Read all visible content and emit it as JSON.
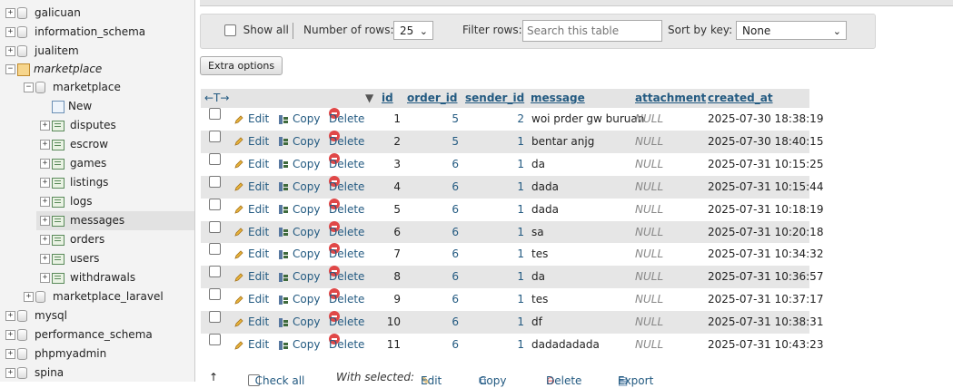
{
  "nav": {
    "items": [
      {
        "label": "galicuan",
        "depth": 0
      },
      {
        "label": "information_schema",
        "depth": 0
      },
      {
        "label": "jualitem",
        "depth": 0
      },
      {
        "label": "marketplace",
        "depth": 0,
        "italic": true
      },
      {
        "label": "marketplace",
        "depth": 1
      },
      {
        "label": "New",
        "depth": 2
      },
      {
        "label": "disputes",
        "depth": 2
      },
      {
        "label": "escrow",
        "depth": 2
      },
      {
        "label": "games",
        "depth": 2
      },
      {
        "label": "listings",
        "depth": 2
      },
      {
        "label": "logs",
        "depth": 2
      },
      {
        "label": "messages",
        "depth": 2
      },
      {
        "label": "orders",
        "depth": 2
      },
      {
        "label": "users",
        "depth": 2
      },
      {
        "label": "withdrawals",
        "depth": 2
      },
      {
        "label": "marketplace_laravel",
        "depth": 1
      },
      {
        "label": "mysql",
        "depth": 0
      },
      {
        "label": "performance_schema",
        "depth": 0
      },
      {
        "label": "phpmyadmin",
        "depth": 0
      },
      {
        "label": "spina",
        "depth": 0
      }
    ]
  },
  "controls": {
    "show_all": "Show all",
    "num_rows_label": "Number of rows:",
    "num_rows_value": "25",
    "filter_label": "Filter rows:",
    "filter_placeholder": "Search this table",
    "sort_label": "Sort by key:",
    "sort_value": "None",
    "extra_options": "Extra options"
  },
  "table": {
    "arrows": "←T→",
    "columns": [
      "id",
      "order_id",
      "sender_id",
      "message",
      "attachment",
      "created_at"
    ],
    "actions": {
      "edit": "Edit",
      "copy": "Copy",
      "delete": "Delete"
    },
    "rows": [
      {
        "id": "1",
        "order_id": "5",
        "sender_id": "2",
        "message": "woi prder gw buruan",
        "attachment": "NULL",
        "created_at": "2025-07-30 18:38:19"
      },
      {
        "id": "2",
        "order_id": "5",
        "sender_id": "1",
        "message": "bentar anjg",
        "attachment": "NULL",
        "created_at": "2025-07-30 18:40:15"
      },
      {
        "id": "3",
        "order_id": "6",
        "sender_id": "1",
        "message": "da",
        "attachment": "NULL",
        "created_at": "2025-07-31 10:15:25"
      },
      {
        "id": "4",
        "order_id": "6",
        "sender_id": "1",
        "message": "dada",
        "attachment": "NULL",
        "created_at": "2025-07-31 10:15:44"
      },
      {
        "id": "5",
        "order_id": "6",
        "sender_id": "1",
        "message": "dada",
        "attachment": "NULL",
        "created_at": "2025-07-31 10:18:19"
      },
      {
        "id": "6",
        "order_id": "6",
        "sender_id": "1",
        "message": "sa",
        "attachment": "NULL",
        "created_at": "2025-07-31 10:20:18"
      },
      {
        "id": "7",
        "order_id": "6",
        "sender_id": "1",
        "message": "tes",
        "attachment": "NULL",
        "created_at": "2025-07-31 10:34:32"
      },
      {
        "id": "8",
        "order_id": "6",
        "sender_id": "1",
        "message": "da",
        "attachment": "NULL",
        "created_at": "2025-07-31 10:36:57"
      },
      {
        "id": "9",
        "order_id": "6",
        "sender_id": "1",
        "message": "tes",
        "attachment": "NULL",
        "created_at": "2025-07-31 10:37:17"
      },
      {
        "id": "10",
        "order_id": "6",
        "sender_id": "1",
        "message": "df",
        "attachment": "NULL",
        "created_at": "2025-07-31 10:38:31"
      },
      {
        "id": "11",
        "order_id": "6",
        "sender_id": "1",
        "message": "dadadadada",
        "attachment": "NULL",
        "created_at": "2025-07-31 10:43:23"
      }
    ]
  },
  "bottom": {
    "check_all": "Check all",
    "with_selected": "With selected:",
    "edit": "Edit",
    "copy": "Copy",
    "delete": "Delete",
    "export": "Export"
  }
}
